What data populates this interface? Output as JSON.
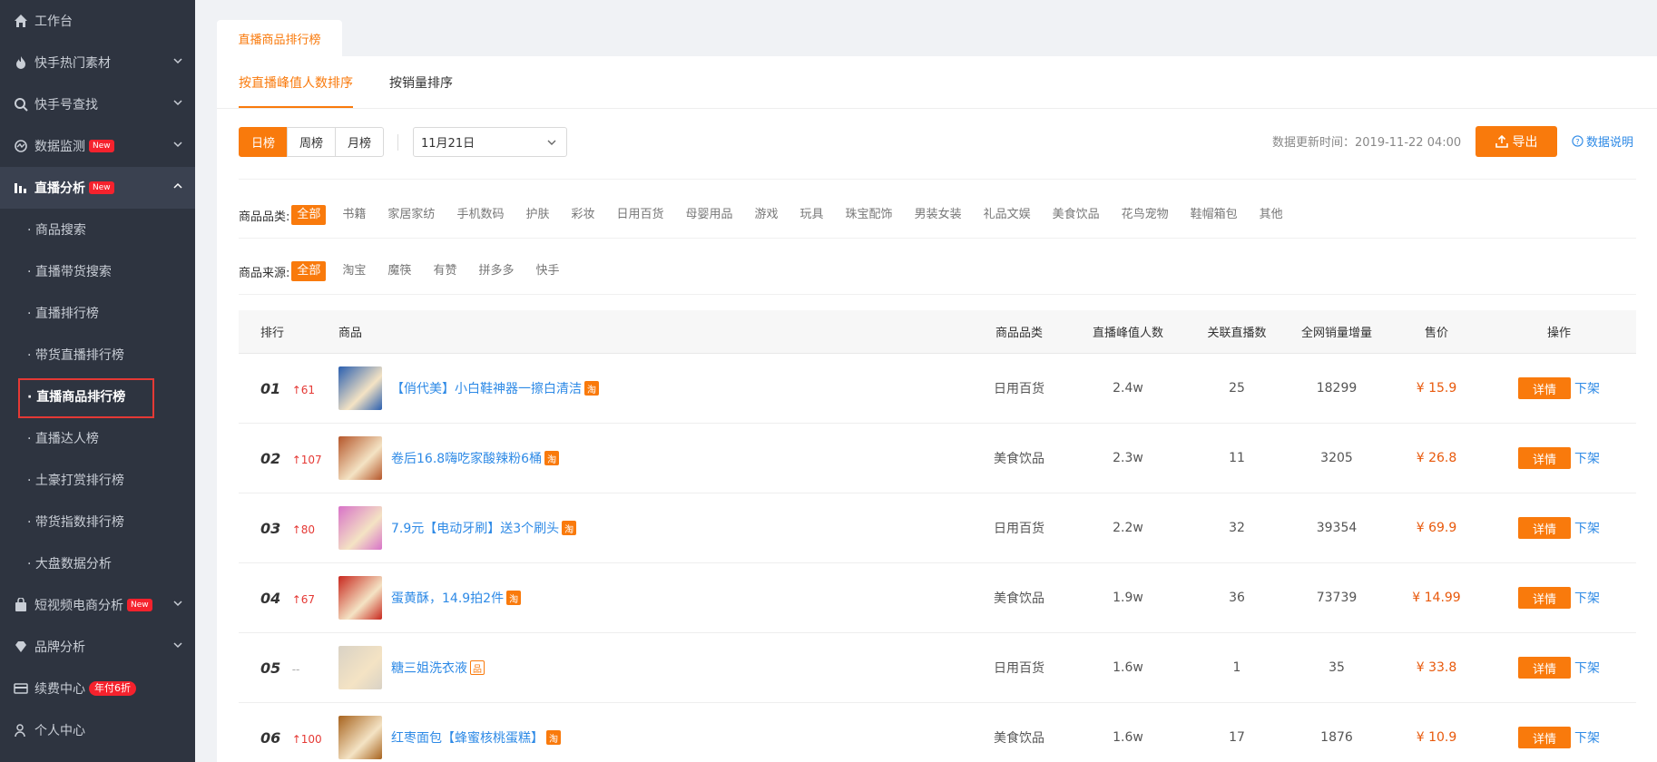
{
  "sidebar": {
    "items": [
      {
        "label": "工作台",
        "icon": "home-icon"
      },
      {
        "label": "快手热门素材",
        "icon": "fire-icon",
        "chevron": "down"
      },
      {
        "label": "快手号查找",
        "icon": "search-icon",
        "chevron": "down"
      },
      {
        "label": "数据监测",
        "icon": "monitor-icon",
        "badge": "New",
        "chevron": "down"
      },
      {
        "label": "直播分析",
        "icon": "bar-chart-icon",
        "badge": "New",
        "chevron": "up"
      }
    ],
    "sub_items": [
      "· 商品搜索",
      "· 直播带货搜索",
      "· 直播排行榜",
      "· 带货直播排行榜",
      "· 直播商品排行榜",
      "· 直播达人榜",
      "· 土豪打赏排行榜",
      "· 带货指数排行榜",
      "· 大盘数据分析"
    ],
    "bottom_items": [
      {
        "label": "短视频电商分析",
        "icon": "bag-icon",
        "badge": "New",
        "chevron": "down"
      },
      {
        "label": "品牌分析",
        "icon": "diamond-icon",
        "chevron": "down"
      },
      {
        "label": "续费中心",
        "icon": "card-icon",
        "promo": "年付6折"
      },
      {
        "label": "个人中心",
        "icon": "user-icon"
      }
    ]
  },
  "page_tab": "直播商品排行榜",
  "sort_tabs": [
    "按直播峰值人数排序",
    "按销量排序"
  ],
  "period": {
    "buttons": [
      "日榜",
      "周榜",
      "月榜"
    ],
    "selected": "日榜"
  },
  "date_value": "11月21日",
  "update_label": "数据更新时间：",
  "update_time": "2019-11-22 04:00",
  "export_label": "导出",
  "help_label": "数据说明",
  "filters": {
    "category_label": "商品品类:",
    "categories": [
      "全部",
      "书籍",
      "家居家纺",
      "手机数码",
      "护肤",
      "彩妆",
      "日用百货",
      "母婴用品",
      "游戏",
      "玩具",
      "珠宝配饰",
      "男装女装",
      "礼品文娱",
      "美食饮品",
      "花鸟宠物",
      "鞋帽箱包",
      "其他"
    ],
    "source_label": "商品来源:",
    "sources": [
      "全部",
      "淘宝",
      "魔筷",
      "有赞",
      "拼多多",
      "快手"
    ]
  },
  "table": {
    "headers": {
      "rank": "排行",
      "product": "商品",
      "category": "商品品类",
      "peak": "直播峰值人数",
      "live": "关联直播数",
      "sales": "全网销量增量",
      "price": "售价",
      "op": "操作"
    },
    "rows": [
      {
        "rank": "01",
        "change": "↑61",
        "name": "【俏代美】小白鞋神器一擦白清洁",
        "tag": "淘",
        "category": "日用百货",
        "peak": "2.4w",
        "live": "25",
        "sales": "18299",
        "price": "¥ 15.9",
        "thumb": "#2a5fb0"
      },
      {
        "rank": "02",
        "change": "↑107",
        "name": "卷后16.8嗨吃家酸辣粉6桶",
        "tag": "淘",
        "category": "美食饮品",
        "peak": "2.3w",
        "live": "11",
        "sales": "3205",
        "price": "¥ 26.8",
        "thumb": "#b5562a"
      },
      {
        "rank": "03",
        "change": "↑80",
        "name": "7.9元【电动牙刷】送3个刷头",
        "tag": "淘",
        "category": "日用百货",
        "peak": "2.2w",
        "live": "32",
        "sales": "39354",
        "price": "¥ 69.9",
        "thumb": "#d873c8"
      },
      {
        "rank": "04",
        "change": "↑67",
        "name": "蛋黄酥，14.9拍2件",
        "tag": "淘",
        "category": "美食饮品",
        "peak": "1.9w",
        "live": "36",
        "sales": "73739",
        "price": "¥ 14.99",
        "thumb": "#c8281e"
      },
      {
        "rank": "05",
        "change": "--",
        "name": "糖三姐洗衣液",
        "tag": "品",
        "category": "日用百货",
        "peak": "1.6w",
        "live": "1",
        "sales": "35",
        "price": "¥ 33.8",
        "thumb": "#d9d2c5"
      },
      {
        "rank": "06",
        "change": "↑100",
        "name": "红枣面包【蜂蜜核桃蛋糕】",
        "tag": "淘",
        "category": "美食饮品",
        "peak": "1.6w",
        "live": "17",
        "sales": "1876",
        "price": "¥ 10.9",
        "thumb": "#a7631e"
      }
    ],
    "detail_label": "详情",
    "unlist_label": "下架"
  },
  "colors": {
    "accent": "#f97a0c",
    "link": "#2e8ae6",
    "sidebar_bg": "#2e3440",
    "highlight_box": "#e53935"
  }
}
